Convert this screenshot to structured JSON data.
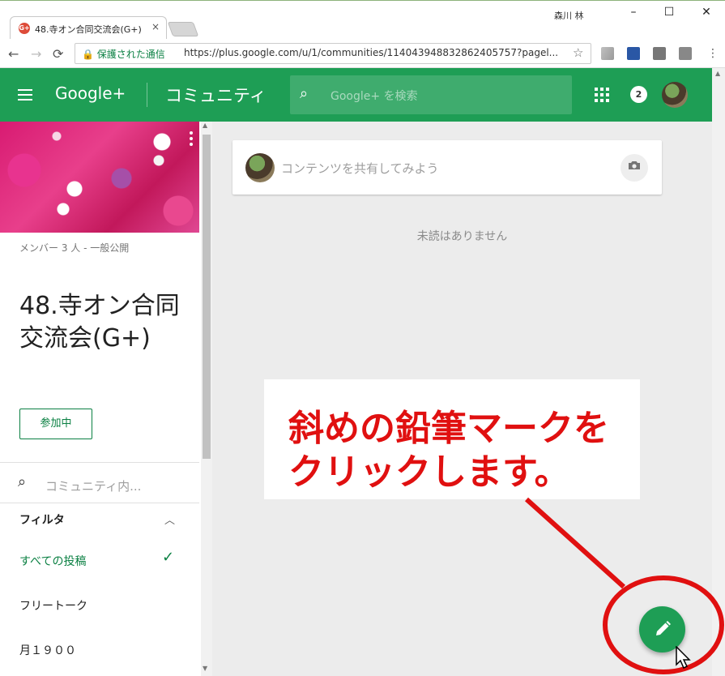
{
  "browser": {
    "tab": {
      "favicon": "G+",
      "title": "48.寺オン合同交流会(G+)",
      "close": "×"
    },
    "window_user": "森川 林",
    "window_controls": {
      "minimize": "–",
      "maximize": "☐",
      "close": "✕"
    },
    "nav": {
      "back": "←",
      "forward": "→",
      "reload": "⟳"
    },
    "secure_label": "保護された通信",
    "url": "https://plus.google.com/u/1/communities/114043948832862405757?pagel...",
    "star": "☆"
  },
  "header": {
    "logo": "Google+",
    "section": "コミュニティ",
    "search_placeholder": "Google+ を検索",
    "notification_count": "2"
  },
  "sidebar": {
    "members": "メンバー 3 人 - 一般公開",
    "community_name": "48.寺オン合同交流会(G+)",
    "join_button": "参加中",
    "search_placeholder": "コミュニティ内...",
    "filter_label": "フィルタ",
    "filters": [
      {
        "label": "すべての投稿",
        "selected": true
      },
      {
        "label": "フリートーク",
        "selected": false
      },
      {
        "label": "月１９００",
        "selected": false
      }
    ]
  },
  "main": {
    "share_placeholder": "コンテンツを共有してみよう",
    "unread_message": "未読はありません"
  },
  "annotation": {
    "text_line1": "斜めの鉛筆マークを",
    "text_line2": "クリックします。",
    "color": "#e01010"
  },
  "colors": {
    "brand_green": "#1e9e55",
    "accent_green": "#0b8043"
  }
}
